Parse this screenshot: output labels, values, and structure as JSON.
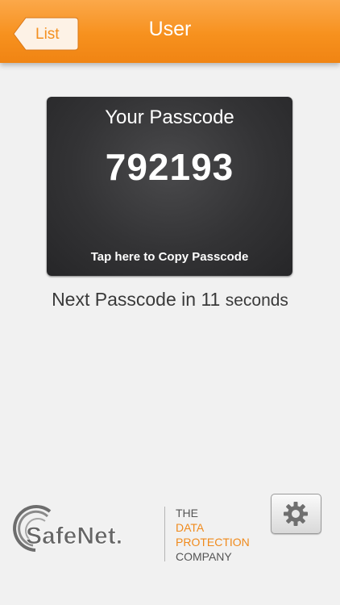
{
  "nav": {
    "back_label": "List",
    "title": "User"
  },
  "passcode_card": {
    "title": "Your Passcode",
    "code": "792193",
    "copy_hint": "Tap here to Copy Passcode"
  },
  "countdown": {
    "prefix": "Next Passcode in",
    "seconds": "11",
    "unit": "seconds"
  },
  "branding": {
    "logo_text": "SafeNet.",
    "tagline_line1": "THE",
    "tagline_line2": "DATA",
    "tagline_line3": "PROTECTION",
    "tagline_line4": "COMPANY"
  },
  "icons": {
    "settings": "gear-icon"
  },
  "colors": {
    "accent_orange": "#f7911e",
    "card_dark": "#333335",
    "background": "#f1f1f1"
  }
}
